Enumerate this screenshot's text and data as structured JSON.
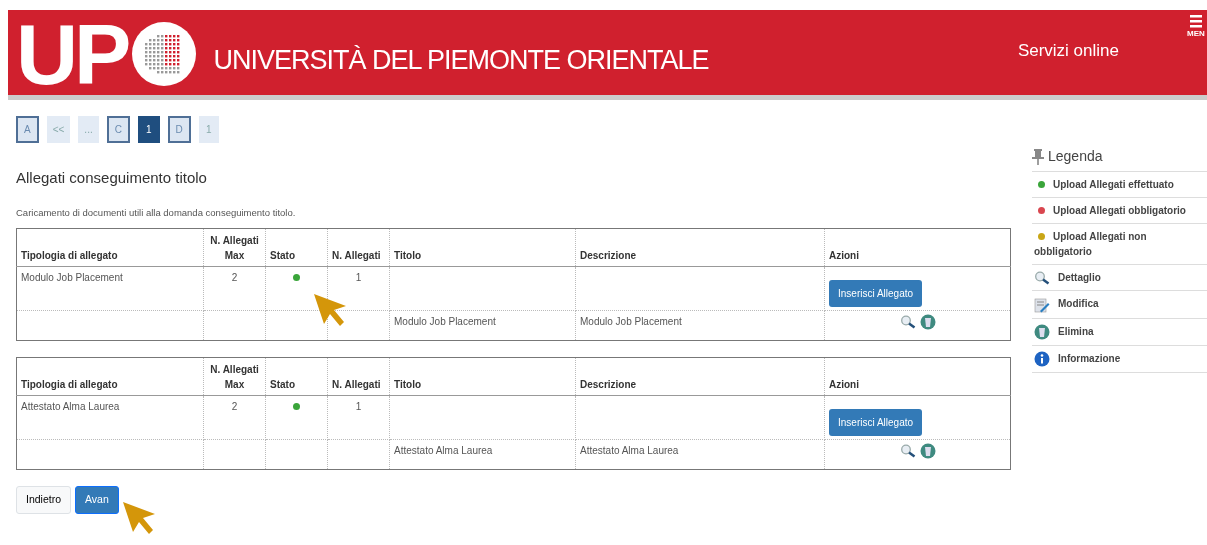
{
  "header": {
    "logo_text": "UP",
    "university": "UNIVERSITÀ DEL PIEMONTE ORIENTALE",
    "services": "Servizi online",
    "menu_label": "MEN"
  },
  "pagination": [
    {
      "label": "A",
      "selected": false,
      "disabled": false
    },
    {
      "label": "<<",
      "selected": false,
      "disabled": true
    },
    {
      "label": "...",
      "selected": false,
      "disabled": true
    },
    {
      "label": "C",
      "selected": false,
      "disabled": false
    },
    {
      "label": "1",
      "selected": true,
      "disabled": false
    },
    {
      "label": "D",
      "selected": false,
      "disabled": false
    },
    {
      "label": "1",
      "selected": false,
      "disabled": true
    }
  ],
  "title": "Allegati conseguimento titolo",
  "description": "Caricamento di documenti utili alla domanda conseguimento titolo.",
  "tables": [
    {
      "columns": [
        "Tipologia di allegato",
        "N. Allegati Max",
        "Stato",
        "N. Allegati",
        "Titolo",
        "Descrizione",
        "Azioni"
      ],
      "row": {
        "type": "Modulo Job Placement",
        "max": "2",
        "uploaded": true,
        "count": "1",
        "button": "Inserisci Allegato"
      },
      "attachment": {
        "title": "Modulo Job Placement",
        "description": "Modulo Job Placement"
      },
      "cursor": true
    },
    {
      "columns": [
        "Tipologia di allegato",
        "N. Allegati Max",
        "Stato",
        "N. Allegati",
        "Titolo",
        "Descrizione",
        "Azioni"
      ],
      "row": {
        "type": "Attestato Alma Laurea",
        "max": "2",
        "uploaded": true,
        "count": "1",
        "button": "Inserisci Allegato"
      },
      "attachment": {
        "title": "Attestato Alma Laurea",
        "description": "Attestato Alma Laurea"
      },
      "cursor": false
    }
  ],
  "buttons": [
    {
      "label": "Indietro",
      "kind": "secondary"
    },
    {
      "label": "Avan",
      "kind": "primary",
      "cursor": true
    }
  ],
  "legend": {
    "title": "Legenda",
    "items": [
      {
        "kind": "dot",
        "color": "#3aa53a",
        "label": "Upload Allegati effettuato"
      },
      {
        "kind": "dot",
        "color": "#d9464f",
        "label": "Upload Allegati obbligatorio"
      },
      {
        "kind": "dot",
        "color": "#c9a616",
        "label": "Upload Allegati non obbligatorio"
      },
      {
        "kind": "search",
        "label": "Dettaglio"
      },
      {
        "kind": "edit",
        "label": "Modifica"
      },
      {
        "kind": "delete",
        "label": "Elimina"
      },
      {
        "kind": "info",
        "label": "Informazione"
      }
    ]
  }
}
